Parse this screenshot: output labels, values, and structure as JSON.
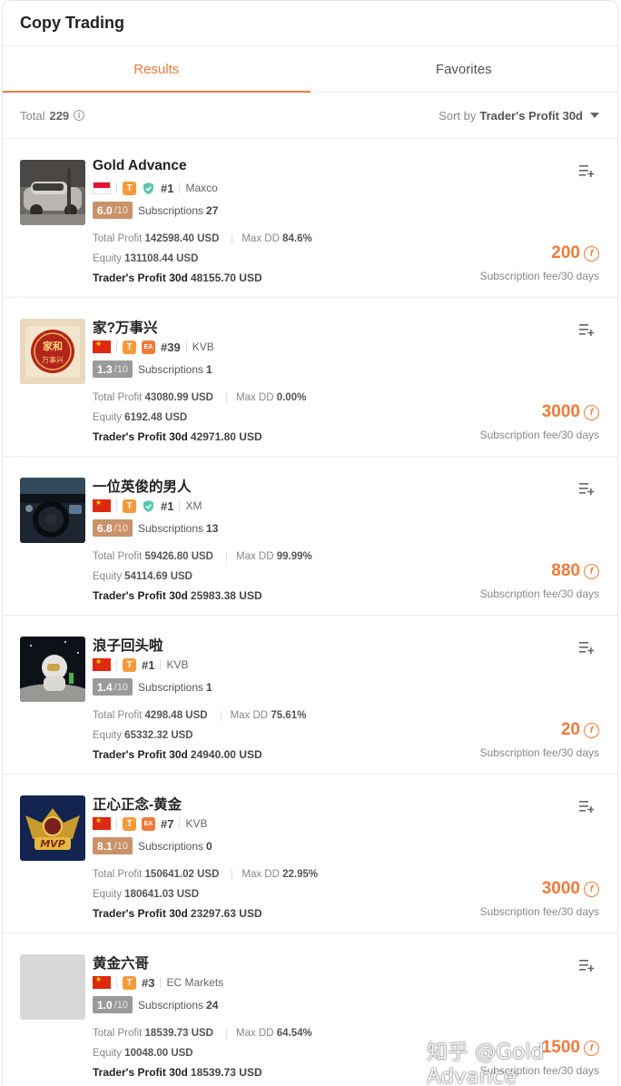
{
  "header": {
    "title": "Copy Trading"
  },
  "tabs": [
    {
      "label": "Results",
      "active": true
    },
    {
      "label": "Favorites",
      "active": false
    }
  ],
  "toolbar": {
    "total_label": "Total",
    "total_value": "229",
    "sort_label": "Sort by",
    "sort_value": "Trader's Profit 30d"
  },
  "labels": {
    "subscriptions": "Subscriptions",
    "total_profit": "Total Profit",
    "max_dd": "Max DD",
    "equity": "Equity",
    "traders_profit": "Trader's Profit 30d",
    "fee_label": "Subscription fee/30 days",
    "score_den": "/10"
  },
  "colors": {
    "accent": "#f07a3a",
    "score_orange": "#c9926a",
    "score_gray": "#9a9a9a"
  },
  "traders": [
    {
      "name": "Gold Advance",
      "flag": "id",
      "has_ea": false,
      "verified": true,
      "rank": "#1",
      "broker": "Maxco",
      "score": "6.0",
      "score_style": "orange",
      "subscriptions": "27",
      "total_profit": "142598.40 USD",
      "max_dd": "84.6%",
      "equity": "131108.44 USD",
      "traders_profit": "48155.70 USD",
      "fee": "200"
    },
    {
      "name": "家?万事兴",
      "flag": "cn",
      "has_ea": true,
      "verified": false,
      "rank": "#39",
      "broker": "KVB",
      "score": "1.3",
      "score_style": "gray",
      "subscriptions": "1",
      "total_profit": "43080.99 USD",
      "max_dd": "0.00%",
      "equity": "6192.48 USD",
      "traders_profit": "42971.80 USD",
      "fee": "3000",
      "avatar_text": "家和万事兴"
    },
    {
      "name": "一位英俊的男人",
      "flag": "cn",
      "has_ea": false,
      "verified": true,
      "rank": "#1",
      "broker": "XM",
      "score": "6.8",
      "score_style": "orange",
      "subscriptions": "13",
      "total_profit": "59426.80 USD",
      "max_dd": "99.99%",
      "equity": "54114.69 USD",
      "traders_profit": "25983.38 USD",
      "fee": "880"
    },
    {
      "name": "浪子回头啦",
      "flag": "cn",
      "has_ea": false,
      "verified": false,
      "rank": "#1",
      "broker": "KVB",
      "score": "1.4",
      "score_style": "gray",
      "subscriptions": "1",
      "total_profit": "4298.48 USD",
      "max_dd": "75.61%",
      "equity": "65332.32 USD",
      "traders_profit": "24940.00 USD",
      "fee": "20"
    },
    {
      "name": "正心正念-黄金",
      "flag": "cn",
      "has_ea": true,
      "verified": false,
      "rank": "#7",
      "broker": "KVB",
      "score": "8.1",
      "score_style": "orange",
      "subscriptions": "0",
      "total_profit": "150641.02 USD",
      "max_dd": "22.95%",
      "equity": "180641.03 USD",
      "traders_profit": "23297.63 USD",
      "fee": "3000",
      "avatar_text": "MVP"
    },
    {
      "name": "黄金六哥",
      "flag": "cn",
      "has_ea": false,
      "verified": false,
      "rank": "#3",
      "broker": "EC Markets",
      "score": "1.0",
      "score_style": "gray",
      "subscriptions": "24",
      "total_profit": "18539.73 USD",
      "max_dd": "64.54%",
      "equity": "10048.00 USD",
      "traders_profit": "18539.73 USD",
      "fee": "1500"
    }
  ],
  "watermark": "知乎 @Gold Advance"
}
